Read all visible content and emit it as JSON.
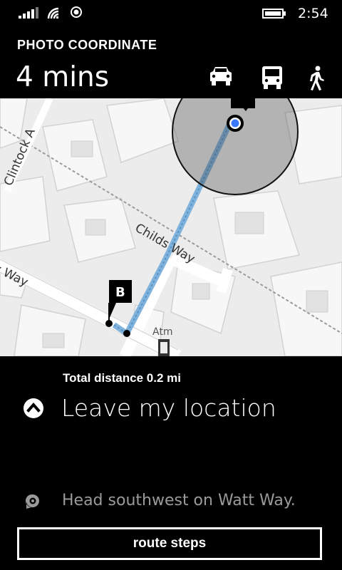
{
  "status_bar": {
    "time": "2:54",
    "icons": [
      "signal-icon",
      "wifi-icon",
      "location-icon",
      "battery-icon"
    ]
  },
  "header": {
    "app_title": "PHOTO COORDINATE",
    "eta": "4 mins",
    "travel_modes": [
      {
        "name": "car",
        "icon": "car-icon"
      },
      {
        "name": "bus",
        "icon": "bus-icon"
      },
      {
        "name": "walk",
        "icon": "walk-icon",
        "selected": true
      }
    ]
  },
  "map": {
    "streets": [
      "Clintock A",
      "Childs Way",
      "y Way"
    ],
    "poi_label": "Atm",
    "destination_marker": "B",
    "route_color": "#7fb2dc",
    "location_color": "#3a78ff"
  },
  "directions": {
    "total_distance": "Total distance 0.2 mi",
    "current_step": "Leave my location",
    "next_step": "Head southwest on Watt Way.",
    "route_steps_label": "route steps"
  }
}
